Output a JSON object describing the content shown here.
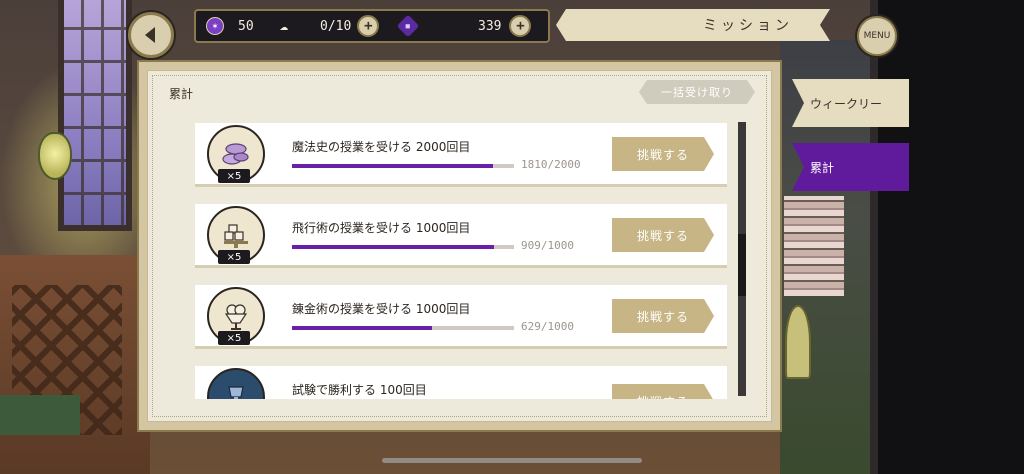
{
  "hud": {
    "magic_gems": "50",
    "stamina": "0/10",
    "premium_gems": "339",
    "mission_title": "ミッション",
    "menu_label": "MENU",
    "plus": "+"
  },
  "panel": {
    "title": "累計",
    "bulk_receive_label": "一括受け取り"
  },
  "tabs": [
    {
      "label": "ウィークリー",
      "active": false
    },
    {
      "label": "累計",
      "active": true
    }
  ],
  "missions": [
    {
      "title": "魔法史の授業を受ける 2000回目",
      "progress": "1810/2000",
      "fraction": 0.905,
      "reward_count": "×5",
      "button": "挑戦する",
      "icon": "macaron-icon"
    },
    {
      "title": "飛行術の授業を受ける 1000回目",
      "progress": "909/1000",
      "fraction": 0.909,
      "reward_count": "×5",
      "button": "挑戦する",
      "icon": "sugar-cubes-icon"
    },
    {
      "title": "錬金術の授業を受ける 1000回目",
      "progress": "629/1000",
      "fraction": 0.629,
      "reward_count": "×5",
      "button": "挑戦する",
      "icon": "parfait-icon"
    },
    {
      "title": "試験で勝利する 100回目",
      "progress": "",
      "fraction": 0,
      "reward_count": "",
      "button": "挑戦する",
      "icon": "trophy-icon"
    }
  ],
  "colors": {
    "accent_purple": "#6a1fa8",
    "tab_active": "#5f1b9c",
    "button_gold": "#c7b586"
  }
}
